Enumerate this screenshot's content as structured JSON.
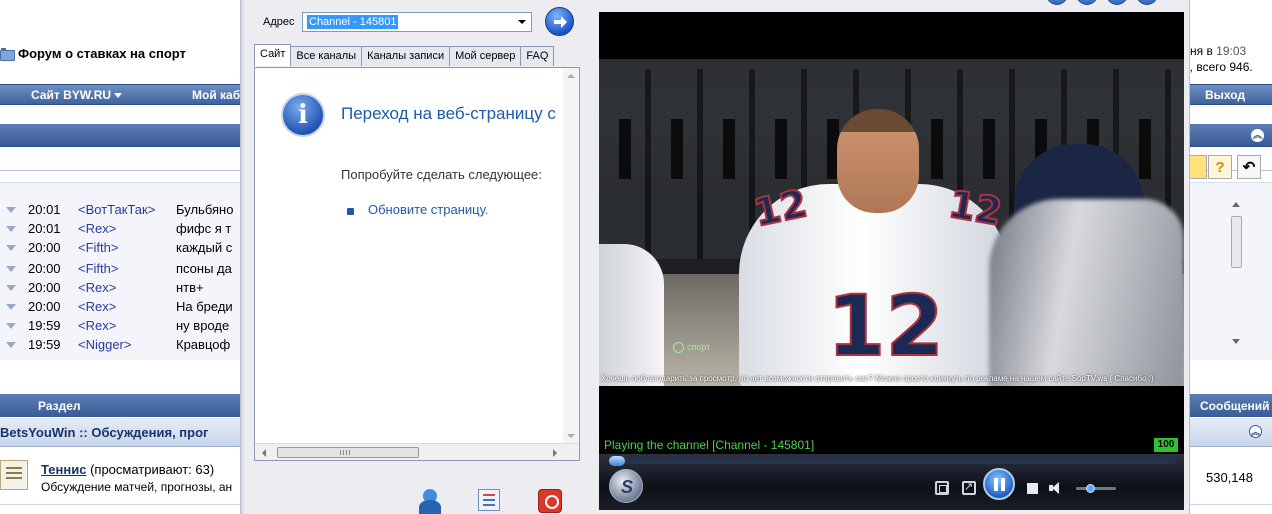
{
  "forum": {
    "title": "Форум о ставках на спорт",
    "right_info_line1_prefix": "дня в ",
    "right_info_time": "19:03",
    "right_info_line2": "0, всего 946.",
    "nav": {
      "site": "Сайт BYW.RU",
      "cabinet": "Мой каб",
      "logout": "Выход"
    },
    "chat": [
      {
        "time": "20:01",
        "nick": "<ВотТакТак>",
        "msg": "Бульбяно"
      },
      {
        "time": "20:01",
        "nick": "<Rex>",
        "msg": "фифс я т"
      },
      {
        "time": "20:00",
        "nick": "<Fifth>",
        "msg": "каждый с"
      },
      {
        "time": "20:00",
        "nick": "<Fifth>",
        "msg": "псоны да"
      },
      {
        "time": "20:00",
        "nick": "<Rex>",
        "msg": "нтв+"
      },
      {
        "time": "20:00",
        "nick": "<Rex>",
        "msg": "На бреди"
      },
      {
        "time": "19:59",
        "nick": "<Rex>",
        "msg": "ну вроде"
      },
      {
        "time": "19:59",
        "nick": "<Nigger>",
        "msg": "Кравцоф"
      }
    ],
    "toolbar": {
      "help_label": "?",
      "undo_label": "↶"
    },
    "table": {
      "col_section": "Раздел",
      "col_messages": "Сообщений"
    },
    "category": "BetsYouWin :: Обсуждения, прог",
    "row": {
      "name": "Теннис",
      "viewing": "(просматривают: 63)",
      "desc": "Обсуждение матчей, прогнозы, ан",
      "count": "530,148"
    }
  },
  "app": {
    "address_label": "Адрес",
    "address_value": "Channel - 145801",
    "tabs": [
      {
        "label": "Сайт"
      },
      {
        "label": "Все каналы"
      },
      {
        "label": "Каналы записи"
      },
      {
        "label": "Мой сервер"
      },
      {
        "label": "FAQ"
      }
    ],
    "browser": {
      "error_title": "Переход на веб-страницу с",
      "try_text": "Попробуйте сделать следующее:",
      "refresh_link": "Обновите страницу."
    }
  },
  "player": {
    "status": "Playing the channel [Channel - 145801]",
    "volume": "100",
    "volume_level": 0.35,
    "seek_position": 0,
    "jersey_number": "12",
    "logo_bug": "спорт",
    "ticker": "Хочешь поблагодарить за просмотр, но нет возможности отправить смс? Можно просто кликнуть по рекламе на нашем сайте SopTV.ws ( Спасибо :)"
  }
}
